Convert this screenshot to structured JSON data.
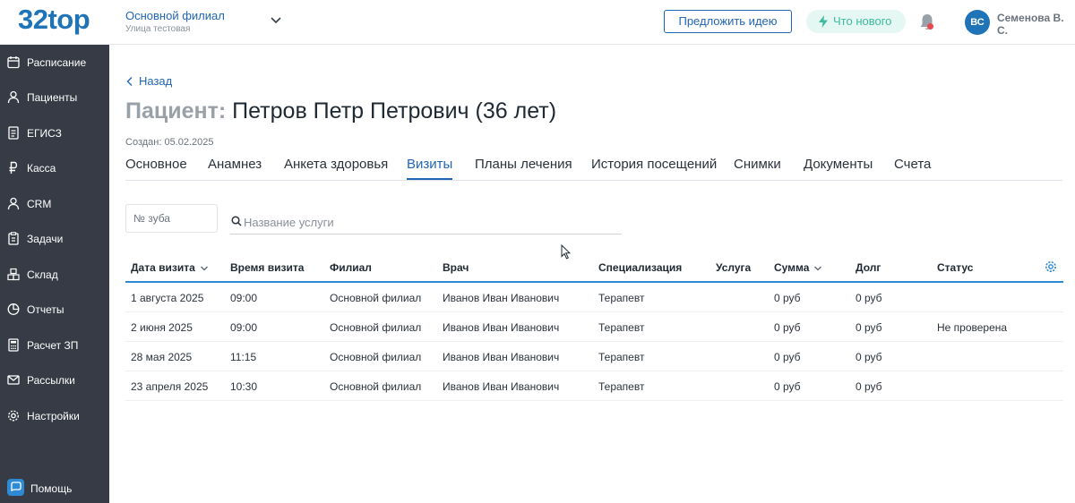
{
  "app": {
    "logo": "32top",
    "branch_name": "Основной филиал",
    "branch_address": "Улица тестовая",
    "suggest_idea": "Предложить идею",
    "whats_new": "Что нового",
    "user_initials": "ВС",
    "user_name": "Семенова В. С."
  },
  "sidebar": {
    "items": [
      {
        "label": "Расписание",
        "icon": "calendar-icon"
      },
      {
        "label": "Пациенты",
        "icon": "user-icon"
      },
      {
        "label": "ЕГИСЗ",
        "icon": "document-icon"
      },
      {
        "label": "Касса",
        "icon": "ruble-icon"
      },
      {
        "label": "CRM",
        "icon": "user-icon"
      },
      {
        "label": "Задачи",
        "icon": "clipboard-icon"
      },
      {
        "label": "Склад",
        "icon": "boxes-icon"
      },
      {
        "label": "Отчеты",
        "icon": "pie-chart-icon"
      },
      {
        "label": "Расчет ЗП",
        "icon": "calculator-icon"
      },
      {
        "label": "Рассылки",
        "icon": "mail-icon"
      },
      {
        "label": "Настройки",
        "icon": "gear-icon"
      }
    ],
    "help": "Помощь"
  },
  "page": {
    "back": "Назад",
    "title_prefix": "Пациент:",
    "title_name": "Петров Петр Петрович (36 лет)",
    "created": "Создан: 05.02.2025",
    "tabs": [
      "Основное",
      "Анамнез",
      "Анкета здоровья",
      "Визиты",
      "Планы лечения",
      "История посещений",
      "Снимки",
      "Документы",
      "Счета"
    ],
    "active_tab": "Визиты"
  },
  "filters": {
    "tooth_placeholder": "№ зуба",
    "service_placeholder": "Название услуги"
  },
  "table": {
    "columns": [
      "Дата визита",
      "Время визита",
      "Филиал",
      "Врач",
      "Специализация",
      "Услуга",
      "Сумма",
      "Долг",
      "Статус"
    ],
    "rows": [
      [
        "1 августа 2025",
        "09:00",
        "Основной филиал",
        "Иванов Иван Иванович",
        "Терапевт",
        "",
        "0 руб",
        "0 руб",
        ""
      ],
      [
        "2 июня 2025",
        "09:00",
        "Основной филиал",
        "Иванов Иван Иванович",
        "Терапевт",
        "",
        "0 руб",
        "0 руб",
        "Не проверена"
      ],
      [
        "28 мая 2025",
        "11:15",
        "Основной филиал",
        "Иванов Иван Иванович",
        "Терапевт",
        "",
        "0 руб",
        "0 руб",
        ""
      ],
      [
        "23 апреля 2025",
        "10:30",
        "Основной филиал",
        "Иванов Иван Иванович",
        "Терапевт",
        "",
        "0 руб",
        "0 руб",
        ""
      ]
    ]
  },
  "colors": {
    "accent": "#2166b5",
    "sidebar": "#363b45",
    "news": "#3dbb9f"
  }
}
